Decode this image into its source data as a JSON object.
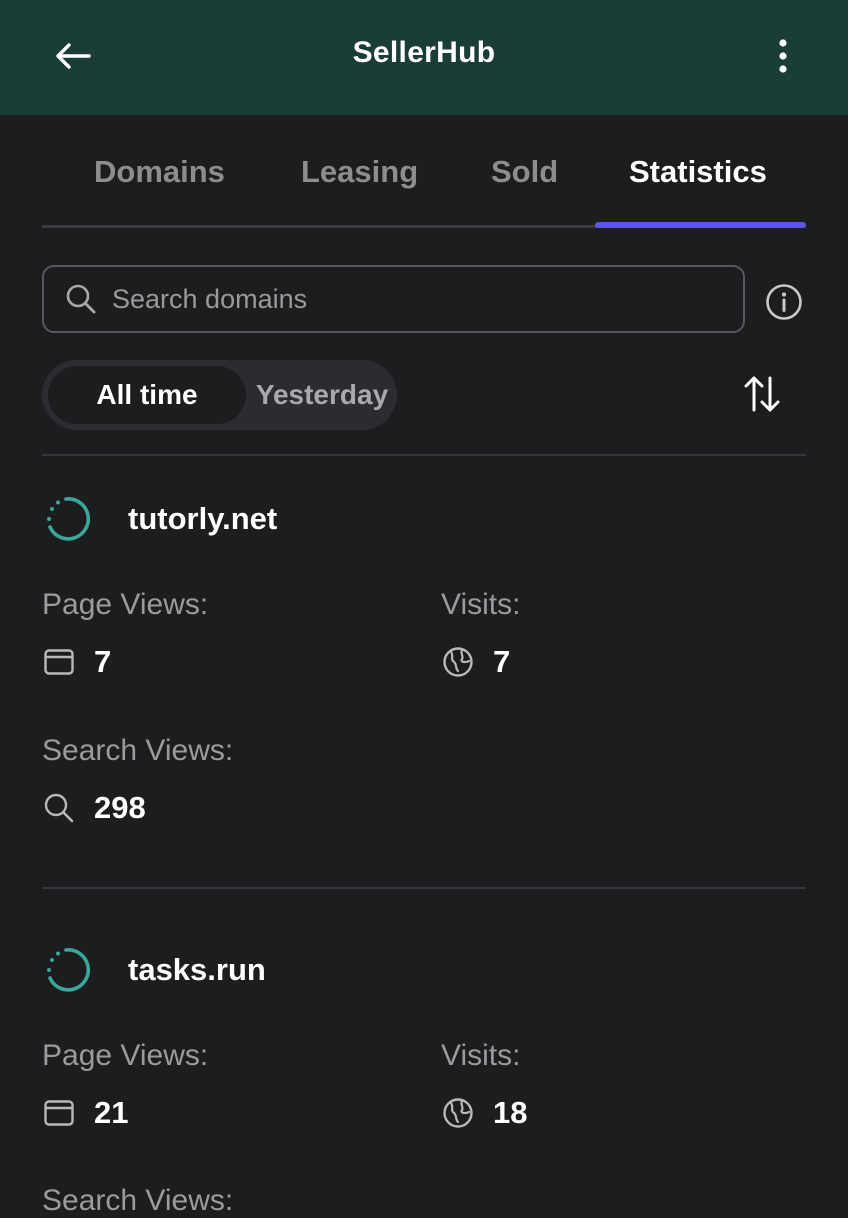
{
  "app": {
    "title": "SellerHub",
    "back_icon": "arrow-left-icon",
    "menu_icon": "more-vertical-icon"
  },
  "tabs": [
    {
      "label": "Domains",
      "active": false
    },
    {
      "label": "Leasing",
      "active": false
    },
    {
      "label": "Sold",
      "active": false
    },
    {
      "label": "Statistics",
      "active": true
    }
  ],
  "search": {
    "placeholder": "Search domains",
    "value": ""
  },
  "filter": {
    "options": [
      "All time",
      "Yesterday"
    ],
    "selected": "All time"
  },
  "domains": [
    {
      "name": "tutorly.net",
      "page_views_label": "Page Views:",
      "page_views": "7",
      "visits_label": "Visits:",
      "visits": "7",
      "search_views_label": "Search Views:",
      "search_views": "298"
    },
    {
      "name": "tasks.run",
      "page_views_label": "Page Views:",
      "page_views": "21",
      "visits_label": "Visits:",
      "visits": "18",
      "search_views_label": "Search Views:",
      "search_views": ""
    }
  ],
  "colors": {
    "header_bg": "#1a3d38",
    "page_bg": "#1c1d1f",
    "tab_indicator": "#5b55ea",
    "spinner": "#3aa79a",
    "muted_text": "#9b9b9e"
  }
}
